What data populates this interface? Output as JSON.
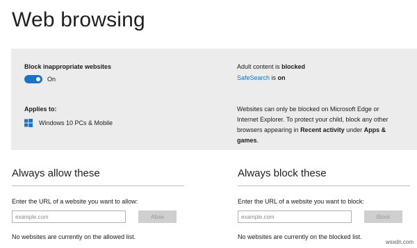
{
  "page": {
    "title": "Web browsing"
  },
  "filter_panel": {
    "block_label": "Block inappropriate websites",
    "toggle_state": "On",
    "toggle_on": true,
    "applies_label": "Applies to:",
    "device_icon": "windows-logo-icon",
    "device_text": "Windows 10 PCs & Mobile",
    "adult_prefix": "Adult content is ",
    "adult_status": "blocked",
    "safesearch_link": "SafeSearch",
    "safesearch_mid": " is ",
    "safesearch_status": "on",
    "info_part1": "Websites can only be blocked on Microsoft Edge or Internet Explorer. To protect your child, block any other browsers appearing in ",
    "info_recent": "Recent activity",
    "info_part2": " under ",
    "info_apps": "Apps & games",
    "info_end": "."
  },
  "allow_section": {
    "title": "Always allow these",
    "url_label": "Enter the URL of a website you want to allow:",
    "placeholder": "example.com",
    "button_label": "Allow",
    "empty_message": "No websites are currently on the allowed list."
  },
  "block_section": {
    "title": "Always block these",
    "url_label": "Enter the URL of a website you want to block:",
    "placeholder": "example.com",
    "button_label": "Block",
    "empty_message": "No websites are currently on the blocked list."
  },
  "watermark": "wsxdn.com",
  "colors": {
    "accent": "#1a73c8",
    "link": "#1a6fbf",
    "panel_bg": "#ececec",
    "button_disabled": "#cfcfcf"
  }
}
